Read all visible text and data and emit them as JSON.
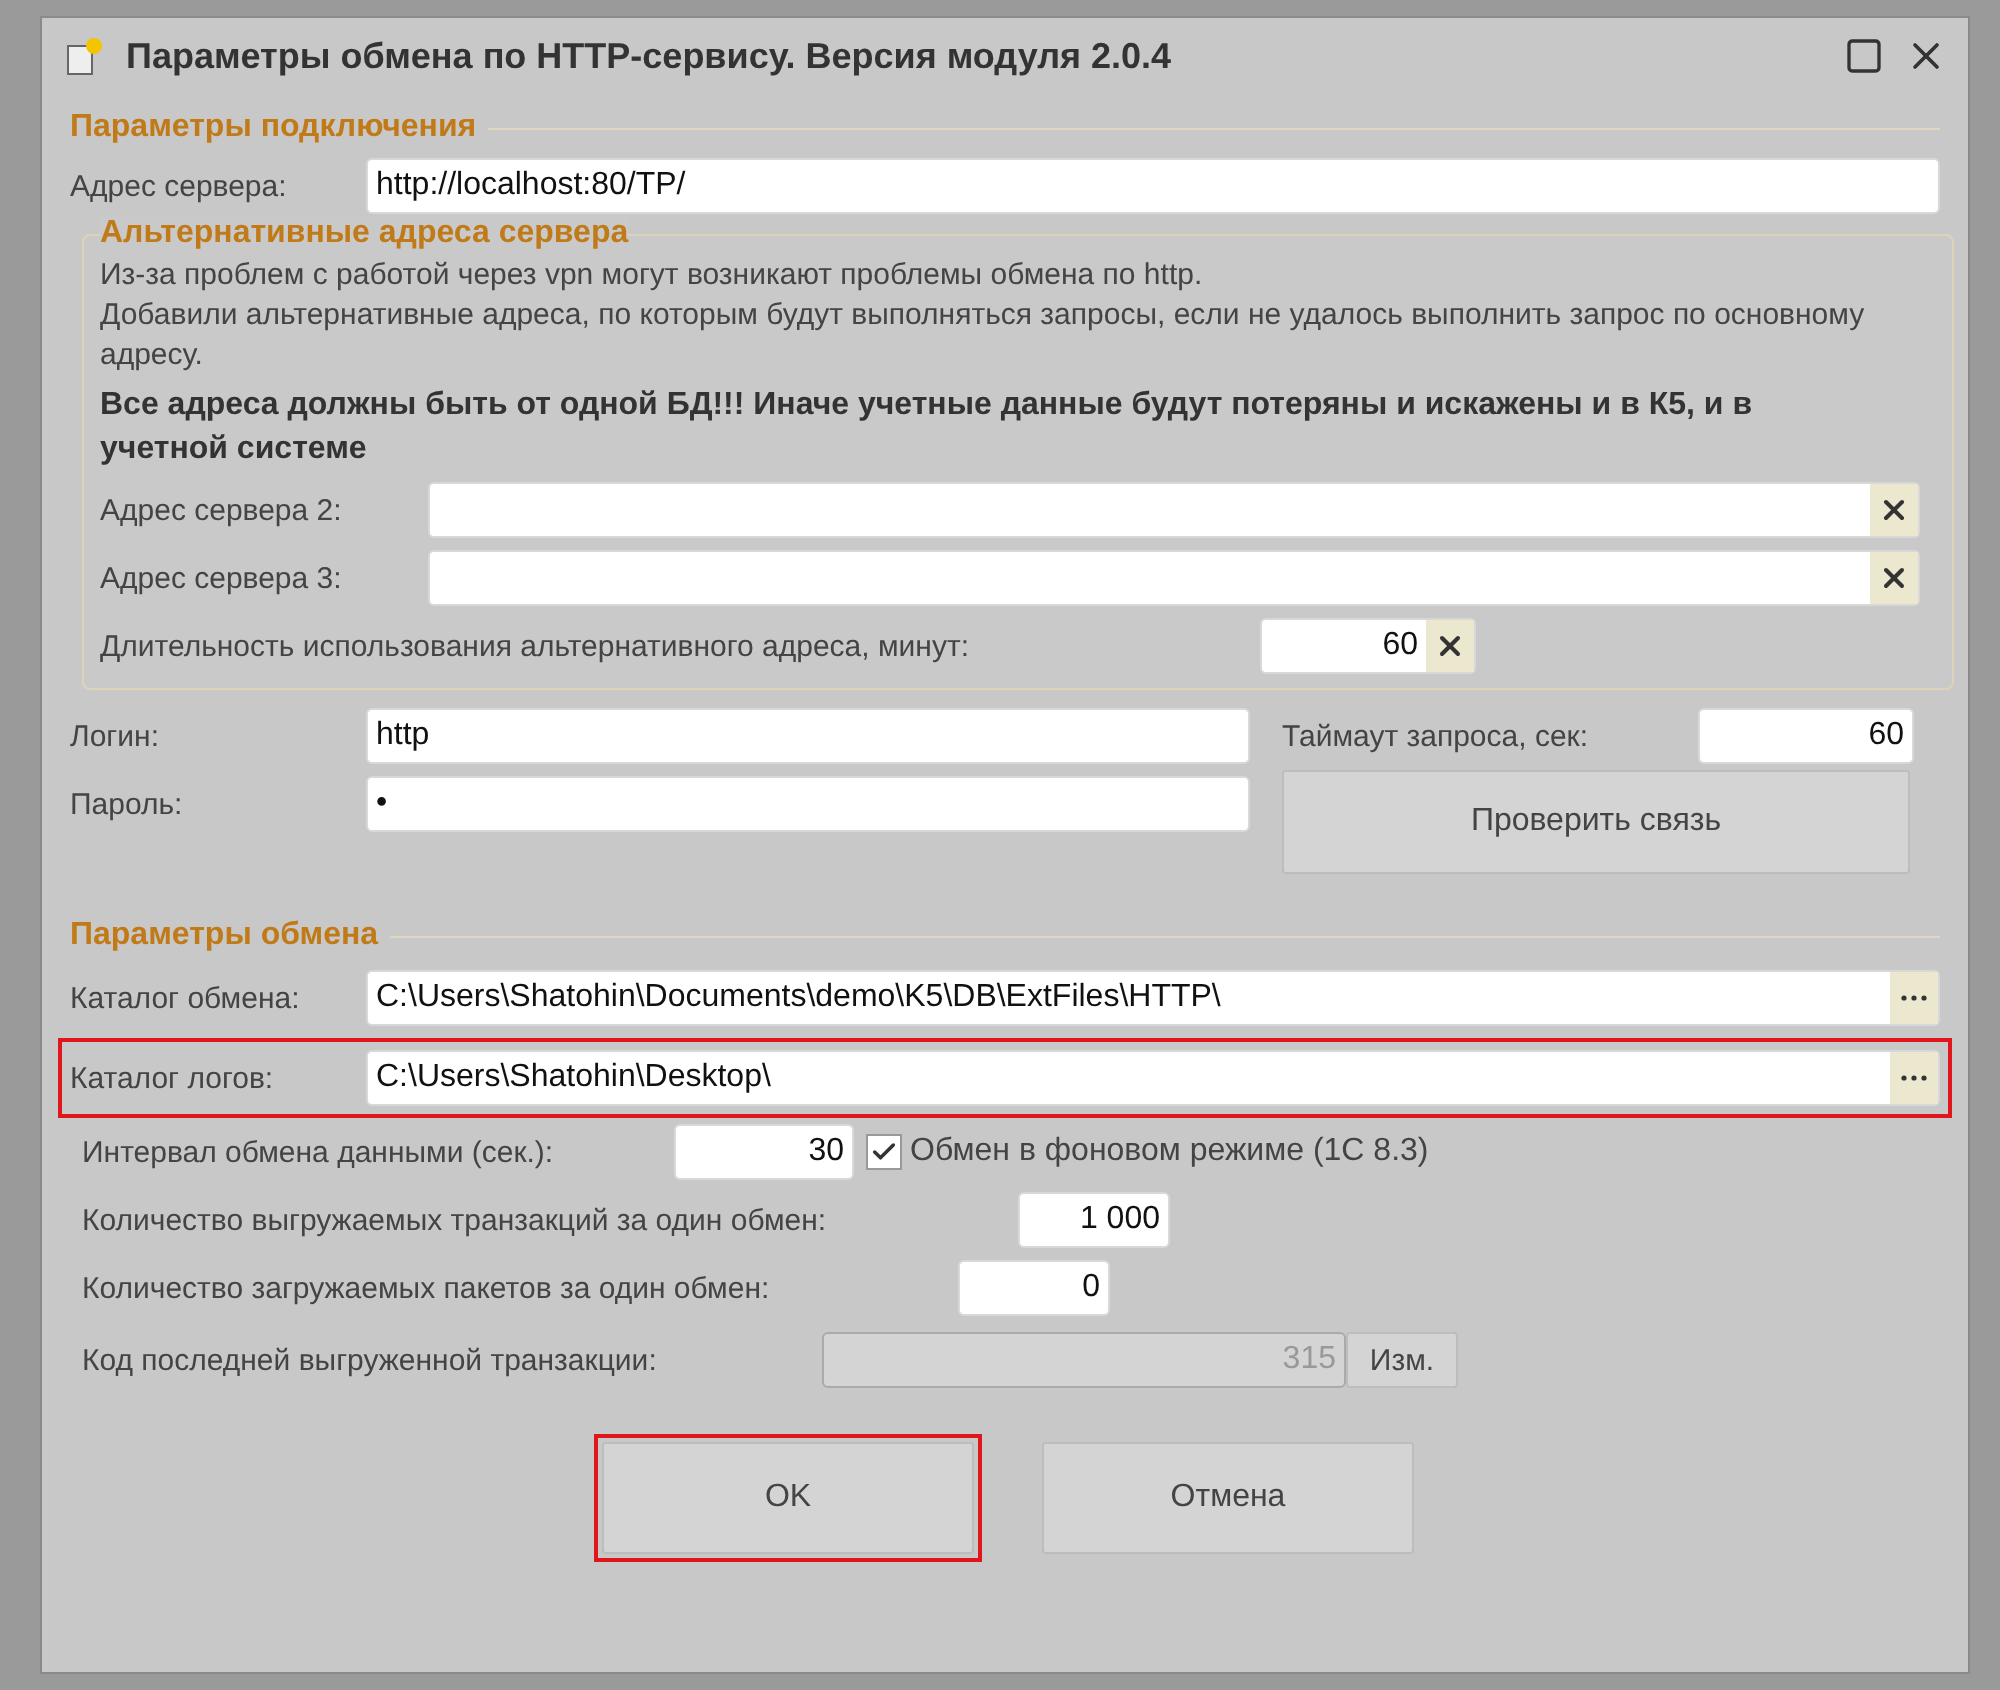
{
  "window": {
    "title": "Параметры обмена по HTTP-сервису. Версия модуля 2.0.4"
  },
  "connection": {
    "heading": "Параметры подключения",
    "server": {
      "label": "Адрес сервера:",
      "value": "http://localhost:80/TP/"
    },
    "alternate": {
      "heading": "Альтернативные адреса сервера",
      "notes": [
        "Из-за проблем с работой через vpn могут возникают проблемы обмена по http.",
        "Добавили альтернативные адреса, по которым будут выполняться запросы, если не удалось выполнить запрос по основному адресу."
      ],
      "warning": "Все адреса должны быть от одной БД!!! Иначе учетные данные будут потеряны и искажены и в К5, и в учетной системе",
      "servers": [
        {
          "label": "Адрес сервера 2:"
        },
        {
          "label": "Адрес сервера 3:"
        }
      ],
      "duration": {
        "label": "Длительность использования альтернативного адреса, минут:",
        "value": "60"
      }
    },
    "login": {
      "label": "Логин:",
      "value": "http"
    },
    "password": {
      "label": "Пароль:",
      "value": "•"
    },
    "timeout": {
      "label": "Таймаут запроса, сек:",
      "value": "60"
    },
    "check_button": "Проверить связь"
  },
  "exchange": {
    "heading": "Параметры обмена",
    "catalogs": [
      {
        "label": "Каталог обмена:",
        "value": "C:\\Users\\Shatohin\\Documents\\demo\\K5\\DB\\ExtFiles\\HTTP\\",
        "highlighted": false
      },
      {
        "label": "Каталог логов:",
        "value": "C:\\Users\\Shatohin\\Desktop\\",
        "highlighted": true
      }
    ],
    "interval": {
      "label": "Интервал обмена данными (сек.):",
      "value": "30"
    },
    "background": {
      "label": "Обмен в фоновом режиме (1С 8.3)",
      "checked": true
    },
    "export_count": {
      "label": "Количество выгружаемых транзакций за один обмен:",
      "value": "1 000"
    },
    "import_count": {
      "label": "Количество загружаемых пакетов за один обмен:",
      "value": "0"
    },
    "last_code": {
      "label": "Код последней выгруженной транзакции:",
      "value": "315",
      "disabled": true
    },
    "change_button": "Изм."
  },
  "buttons": [
    {
      "label": "OK",
      "highlighted": true
    },
    {
      "label": "Отмена",
      "highlighted": false
    }
  ]
}
